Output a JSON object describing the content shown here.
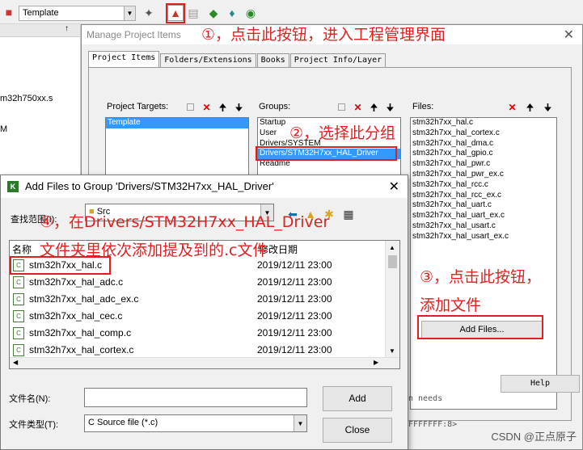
{
  "toolbar": {
    "target_value": "Template"
  },
  "left_panel": {
    "pin": "↑",
    "file_label": "m32h750xx.s",
    "m_label": "M"
  },
  "manage": {
    "title": "Manage Project Items",
    "close": "✕",
    "tabs": [
      "Project Items",
      "Folders/Extensions",
      "Books",
      "Project Info/Layer"
    ],
    "targets_label": "Project Targets:",
    "targets": [
      "Template"
    ],
    "groups_label": "Groups:",
    "groups": [
      "Startup",
      "User",
      "Drivers/SYSTEM",
      "Drivers/STM32H7xx_HAL_Driver",
      "Readme"
    ],
    "files_label": "Files:",
    "files": [
      "stm32h7xx_hal.c",
      "stm32h7xx_hal_cortex.c",
      "stm32h7xx_hal_dma.c",
      "stm32h7xx_hal_gpio.c",
      "stm32h7xx_hal_pwr.c",
      "stm32h7xx_hal_pwr_ex.c",
      "stm32h7xx_hal_rcc.c",
      "stm32h7xx_hal_rcc_ex.c",
      "stm32h7xx_hal_uart.c",
      "stm32h7xx_hal_uart_ex.c",
      "stm32h7xx_hal_usart.c",
      "stm32h7xx_hal_usart_ex.c"
    ],
    "add_files_label": "Add Files...",
    "help_label": "Help"
  },
  "background_code": {
    "line1": "n needs",
    "line2": "FFFFFFF:8>"
  },
  "add_dialog": {
    "title": "Add Files to Group 'Drivers/STM32H7xx_HAL_Driver'",
    "close": "✕",
    "look_in_label": "查找范围(I):",
    "look_in_value": "Src",
    "col_name": "名称",
    "col_date": "修改日期",
    "files": [
      {
        "name": "stm32h7xx_hal.c",
        "date": "2019/12/11 23:00"
      },
      {
        "name": "stm32h7xx_hal_adc.c",
        "date": "2019/12/11 23:00"
      },
      {
        "name": "stm32h7xx_hal_adc_ex.c",
        "date": "2019/12/11 23:00"
      },
      {
        "name": "stm32h7xx_hal_cec.c",
        "date": "2019/12/11 23:00"
      },
      {
        "name": "stm32h7xx_hal_comp.c",
        "date": "2019/12/11 23:00"
      },
      {
        "name": "stm32h7xx_hal_cortex.c",
        "date": "2019/12/11 23:00"
      }
    ],
    "filename_label": "文件名(N):",
    "filename_value": "",
    "filetype_label": "文件类型(T):",
    "filetype_value": "C Source file (*.c)",
    "add_label": "Add",
    "close_label": "Close"
  },
  "annotations": {
    "a1": "①，点击此按钮，进入工程管理界面",
    "a2": "②，选择此分组",
    "a3_line1": "③，点击此按钮，",
    "a3_line2": "添加文件",
    "a4_line1": "④，在Drivers/STM32H7xx_HAL_Driver",
    "a4_line2": "文件夹里依次添加提及到的.c文件"
  },
  "watermark": "CSDN @正点原子",
  "colors": {
    "annotation": "#e02020",
    "selection": "#3399ff"
  }
}
